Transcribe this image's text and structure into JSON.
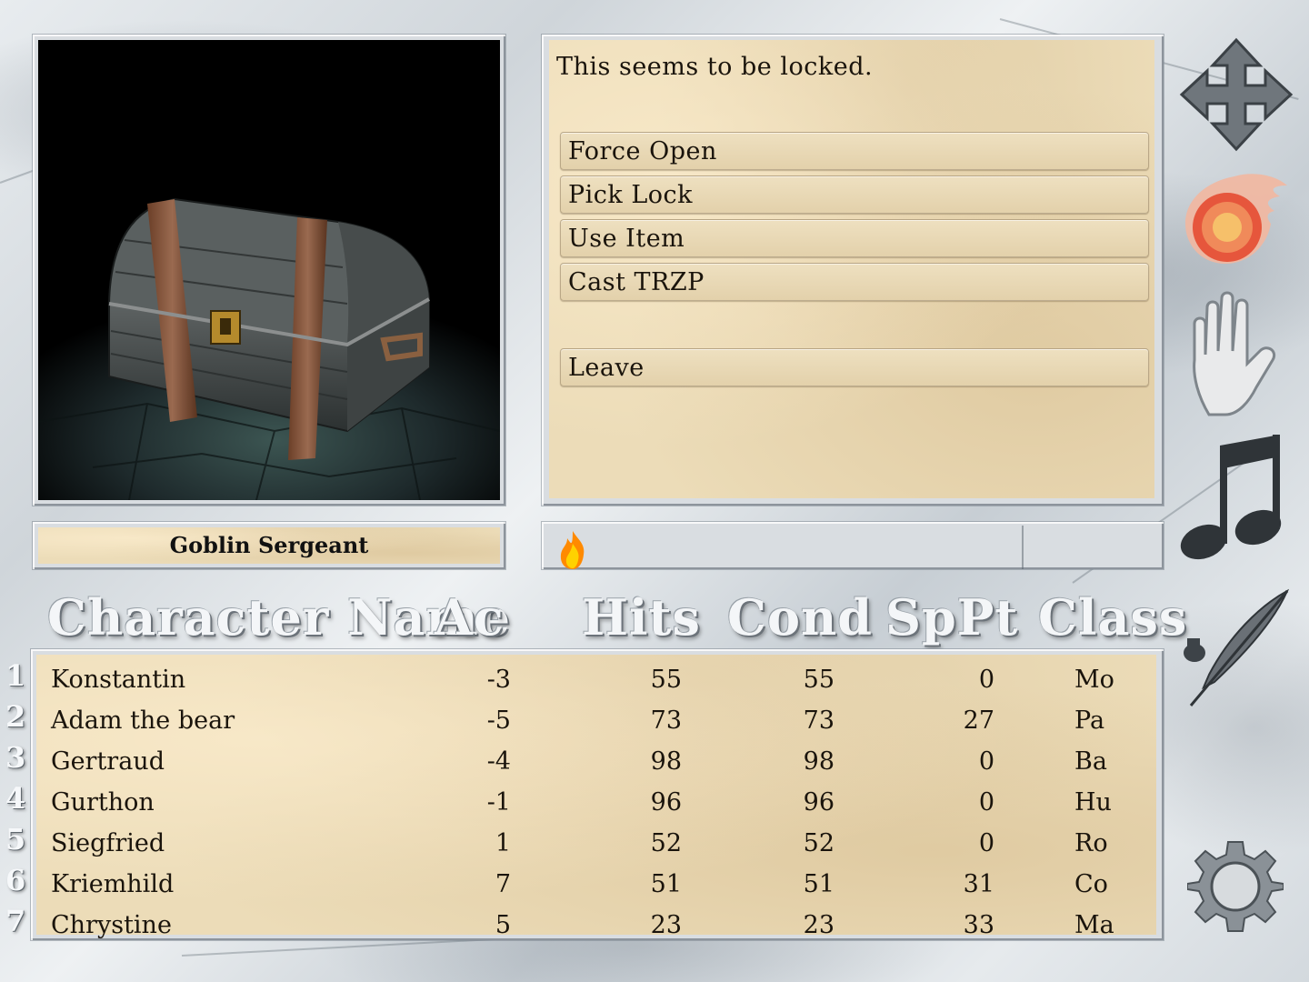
{
  "portrait": {
    "subject": "treasure-chest"
  },
  "message": {
    "text": "This seems to be locked.",
    "options": [
      {
        "label": "Force Open"
      },
      {
        "label": "Pick Lock"
      },
      {
        "label": "Use Item"
      },
      {
        "label": "Cast TRZP"
      },
      {
        "label": "Leave"
      }
    ]
  },
  "nameplate": {
    "name": "Goblin Sergeant"
  },
  "headers": {
    "name": "Character Name",
    "ac": "Ac",
    "hits": "Hits",
    "cond": "Cond",
    "spt": "SpPt",
    "class": "Class"
  },
  "party": [
    {
      "num": "1",
      "name": "Konstantin",
      "ac": "-3",
      "hits": "55",
      "cond": "55",
      "spt": "0",
      "class": "Mo"
    },
    {
      "num": "2",
      "name": "Adam the bear",
      "ac": "-5",
      "hits": "73",
      "cond": "73",
      "spt": "27",
      "class": "Pa"
    },
    {
      "num": "3",
      "name": "Gertraud",
      "ac": "-4",
      "hits": "98",
      "cond": "98",
      "spt": "0",
      "class": "Ba"
    },
    {
      "num": "4",
      "name": "Gurthon",
      "ac": "-1",
      "hits": "96",
      "cond": "96",
      "spt": "0",
      "class": "Hu"
    },
    {
      "num": "5",
      "name": "Siegfried",
      "ac": "1",
      "hits": "52",
      "cond": "52",
      "spt": "0",
      "class": "Ro"
    },
    {
      "num": "6",
      "name": "Kriemhild",
      "ac": "7",
      "hits": "51",
      "cond": "51",
      "spt": "31",
      "class": "Co"
    },
    {
      "num": "7",
      "name": "Chrystine",
      "ac": "5",
      "hits": "23",
      "cond": "23",
      "spt": "33",
      "class": "Ma"
    }
  ],
  "sidebar_icons": [
    "move-arrows-icon",
    "fireball-icon",
    "hand-icon",
    "music-note-icon",
    "quill-icon",
    "gear-icon"
  ],
  "colors": {
    "parchment": "#ecdcb8",
    "text": "#1a140c",
    "marble": "#d9dde1"
  }
}
